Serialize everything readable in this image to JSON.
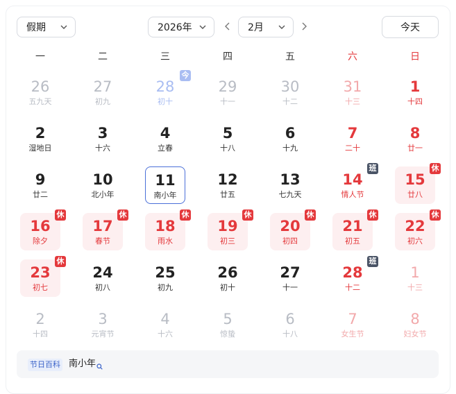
{
  "toolbar": {
    "holiday_select": "假期",
    "year_select": "2026年",
    "month_select": "2月",
    "today_button": "今天"
  },
  "weekdays": [
    "一",
    "二",
    "三",
    "四",
    "五",
    "六",
    "日"
  ],
  "days": [
    {
      "num": "26",
      "sub": "五九天",
      "other": true
    },
    {
      "num": "27",
      "sub": "初九",
      "other": true
    },
    {
      "num": "28",
      "sub": "初十",
      "other": true,
      "today": true,
      "tag": "今"
    },
    {
      "num": "29",
      "sub": "十一",
      "other": true
    },
    {
      "num": "30",
      "sub": "十二",
      "other": true
    },
    {
      "num": "31",
      "sub": "十三",
      "other": true
    },
    {
      "num": "1",
      "sub": "十四"
    },
    {
      "num": "2",
      "sub": "湿地日"
    },
    {
      "num": "3",
      "sub": "十六"
    },
    {
      "num": "4",
      "sub": "立春"
    },
    {
      "num": "5",
      "sub": "十八"
    },
    {
      "num": "6",
      "sub": "十九"
    },
    {
      "num": "7",
      "sub": "二十"
    },
    {
      "num": "8",
      "sub": "廿一"
    },
    {
      "num": "9",
      "sub": "廿二"
    },
    {
      "num": "10",
      "sub": "北小年"
    },
    {
      "num": "11",
      "sub": "南小年",
      "selected": true
    },
    {
      "num": "12",
      "sub": "廿五"
    },
    {
      "num": "13",
      "sub": "七九天"
    },
    {
      "num": "14",
      "sub": "情人节",
      "tag": "班",
      "workday": true
    },
    {
      "num": "15",
      "sub": "廿八",
      "tag": "休",
      "holiday": true
    },
    {
      "num": "16",
      "sub": "除夕",
      "tag": "休",
      "holiday": true
    },
    {
      "num": "17",
      "sub": "春节",
      "tag": "休",
      "holiday": true
    },
    {
      "num": "18",
      "sub": "雨水",
      "tag": "休",
      "holiday": true
    },
    {
      "num": "19",
      "sub": "初三",
      "tag": "休",
      "holiday": true
    },
    {
      "num": "20",
      "sub": "初四",
      "tag": "休",
      "holiday": true
    },
    {
      "num": "21",
      "sub": "初五",
      "tag": "休",
      "holiday": true
    },
    {
      "num": "22",
      "sub": "初六",
      "tag": "休",
      "holiday": true
    },
    {
      "num": "23",
      "sub": "初七",
      "tag": "休",
      "holiday": true
    },
    {
      "num": "24",
      "sub": "初八"
    },
    {
      "num": "25",
      "sub": "初九"
    },
    {
      "num": "26",
      "sub": "初十"
    },
    {
      "num": "27",
      "sub": "十一"
    },
    {
      "num": "28",
      "sub": "十二",
      "tag": "班",
      "workday": true
    },
    {
      "num": "1",
      "sub": "十三",
      "other": true
    },
    {
      "num": "2",
      "sub": "十四",
      "other": true
    },
    {
      "num": "3",
      "sub": "元宵节",
      "other": true
    },
    {
      "num": "4",
      "sub": "十六",
      "other": true
    },
    {
      "num": "5",
      "sub": "惊蛰",
      "other": true
    },
    {
      "num": "6",
      "sub": "十八",
      "other": true
    },
    {
      "num": "7",
      "sub": "女生节",
      "other": true
    },
    {
      "num": "8",
      "sub": "妇女节",
      "other": true
    }
  ],
  "footer": {
    "tag": "节日百科",
    "link": "南小年"
  },
  "colors": {
    "accent_red": "#e4393c",
    "selected_border": "#4a6fd8",
    "holiday_bg": "#fdeff0",
    "work_tag": "#4a5466"
  }
}
